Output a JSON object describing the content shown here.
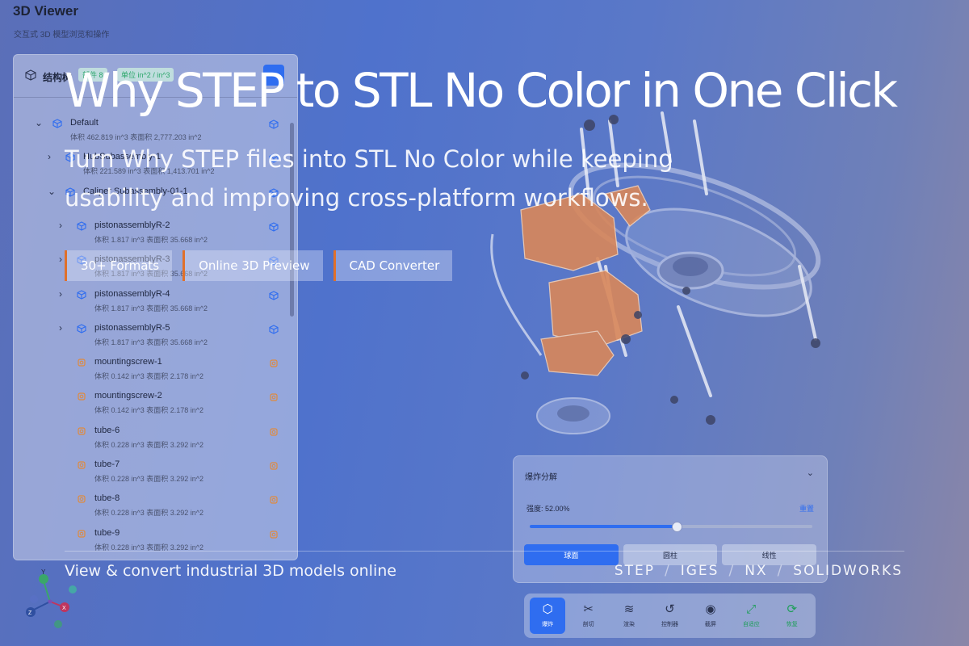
{
  "app": {
    "title": "3D Viewer",
    "subtitle": "交互式 3D 模型浏览和操作"
  },
  "tree": {
    "title": "结构树",
    "chips": [
      "部件 8",
      "单位 in^2 / in^3"
    ],
    "rows": [
      {
        "name": "Default",
        "meta": "体积 462.819 in^3    表面积 2,777.203 in^2",
        "expanded": true,
        "level": 0,
        "type": "assembly"
      },
      {
        "name": "HubSubassembly-1",
        "meta": "体积 221.589 in^3    表面积 1,413.701 in^2",
        "expanded": false,
        "level": 1,
        "type": "assembly"
      },
      {
        "name": "Caliper Subassembly-01-1",
        "meta": "",
        "expanded": true,
        "level": 1,
        "type": "assembly"
      },
      {
        "name": "pistonassemblyR-2",
        "meta": "体积 1.817 in^3    表面积 35.668 in^2",
        "level": 2,
        "type": "assembly"
      },
      {
        "name": "pistonassemblyR-3",
        "meta": "体积 1.817 in^3    表面积 35.668 in^2",
        "level": 2,
        "type": "assembly"
      },
      {
        "name": "pistonassemblyR-4",
        "meta": "体积 1.817 in^3    表面积 35.668 in^2",
        "level": 2,
        "type": "assembly"
      },
      {
        "name": "pistonassemblyR-5",
        "meta": "体积 1.817 in^3    表面积 35.668 in^2",
        "level": 2,
        "type": "assembly"
      },
      {
        "name": "mountingscrew-1",
        "meta": "体积 0.142 in^3    表面积 2.178 in^2",
        "level": 2,
        "type": "part"
      },
      {
        "name": "mountingscrew-2",
        "meta": "体积 0.142 in^3    表面积 2.178 in^2",
        "level": 2,
        "type": "part"
      },
      {
        "name": "tube-6",
        "meta": "体积 0.228 in^3    表面积 3.292 in^2",
        "level": 2,
        "type": "part"
      },
      {
        "name": "tube-7",
        "meta": "体积 0.228 in^3    表面积 3.292 in^2",
        "level": 2,
        "type": "part"
      },
      {
        "name": "tube-8",
        "meta": "体积 0.228 in^3    表面积 3.292 in^2",
        "level": 2,
        "type": "part"
      },
      {
        "name": "tube-9",
        "meta": "体积 0.228 in^3    表面积 3.292 in^2",
        "level": 2,
        "type": "part"
      }
    ]
  },
  "explode": {
    "title": "爆炸分解",
    "strength_label": "强度: 52.00%",
    "strength": 0.52,
    "reset_label": "重置",
    "modes": [
      "球面",
      "圆柱",
      "线性"
    ],
    "active_mode": 0
  },
  "toolbar": [
    {
      "label": "爆炸",
      "icon": "cube-icon",
      "active": true
    },
    {
      "label": "剖切",
      "icon": "scissors-icon",
      "active": false
    },
    {
      "label": "渲染",
      "icon": "layers-icon",
      "active": false
    },
    {
      "label": "控制器",
      "icon": "rotate-icon",
      "active": false
    },
    {
      "label": "截屏",
      "icon": "camera-icon",
      "active": false
    },
    {
      "label": "自适应",
      "icon": "expand-icon",
      "active": false,
      "accent": "#1f9e5a"
    },
    {
      "label": "恢复",
      "icon": "refresh-icon",
      "active": false,
      "accent": "#1f9e5a"
    }
  ],
  "gizmo": {
    "x": "X",
    "y": "Y",
    "z": "Z"
  },
  "overlay": {
    "headline": "Why STEP to STL No Color in One Click",
    "subhead": "Turn Why STEP files into STL No Color while keeping usability and improving cross-platform workflows.",
    "tags": [
      "30+ Formats",
      "Online 3D Preview",
      "CAD Converter"
    ],
    "footer_left": "View & convert industrial 3D models online",
    "formats": [
      "STEP",
      "IGES",
      "NX",
      "SOLIDWORKS"
    ]
  },
  "colors": {
    "accent": "#2f6df0",
    "tag_border": "#e0702a",
    "part_orange": "#e08a3c",
    "success": "#1f9e5a"
  }
}
